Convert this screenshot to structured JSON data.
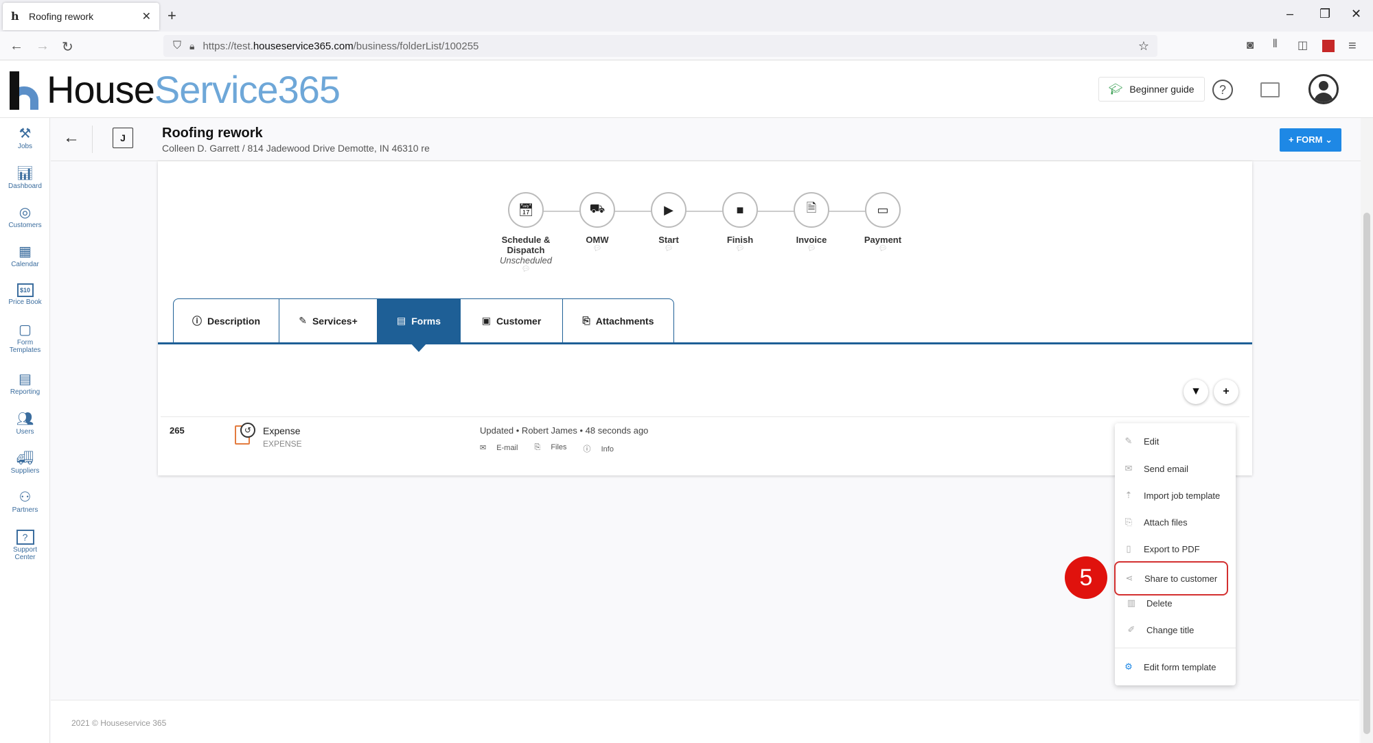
{
  "browser": {
    "tab_title": "Roofing rework",
    "url_prefix": "https://test.",
    "url_host": "houseservice365.com",
    "url_path": "/business/folderList/100255"
  },
  "brand": {
    "word1": "House",
    "word2": "Service365"
  },
  "header": {
    "beginner_guide": "Beginner guide"
  },
  "sidebar": {
    "items": [
      {
        "label": "Jobs",
        "icon": "tools-icon"
      },
      {
        "label": "Dashboard",
        "icon": "bar-chart-icon"
      },
      {
        "label": "Customers",
        "icon": "target-icon"
      },
      {
        "label": "Calendar",
        "icon": "calendar-icon"
      },
      {
        "label": "Price Book",
        "icon": "price-tag-icon"
      },
      {
        "label": "Form Templates",
        "icon": "form-icon"
      },
      {
        "label": "Reporting",
        "icon": "report-icon"
      },
      {
        "label": "Users",
        "icon": "users-icon"
      },
      {
        "label": "Suppliers",
        "icon": "truck-icon"
      },
      {
        "label": "Partners",
        "icon": "partners-icon"
      },
      {
        "label": "Support Center",
        "icon": "support-icon"
      }
    ],
    "price_tag": "$10"
  },
  "job": {
    "badge": "J",
    "title": "Roofing rework",
    "subtitle": "Colleen D. Garrett / 814 Jadewood Drive Demotte, IN 46310 re",
    "form_button": "+ FORM ⌄"
  },
  "steps": [
    {
      "label": "Schedule & Dispatch",
      "sub": "Unscheduled",
      "icon": "calendar-check-icon"
    },
    {
      "label": "OMW",
      "sub": "",
      "icon": "truck-icon"
    },
    {
      "label": "Start",
      "sub": "",
      "icon": "play-icon"
    },
    {
      "label": "Finish",
      "sub": "",
      "icon": "stop-icon"
    },
    {
      "label": "Invoice",
      "sub": "",
      "icon": "document-icon"
    },
    {
      "label": "Payment",
      "sub": "",
      "icon": "card-icon"
    }
  ],
  "tabs": [
    {
      "label": "Description",
      "icon": "ⓘ"
    },
    {
      "label": "Services+",
      "icon": "✎"
    },
    {
      "label": "Forms",
      "icon": "▤"
    },
    {
      "label": "Customer",
      "icon": "▣"
    },
    {
      "label": "Attachments",
      "icon": "⎘"
    }
  ],
  "form_row": {
    "number": "265",
    "name": "Expense",
    "type": "EXPENSE",
    "updated": "Updated • Robert James • 48 seconds ago",
    "links": [
      "E-mail",
      "Files",
      "Info"
    ]
  },
  "menu": {
    "items": [
      {
        "label": "Edit",
        "icon": "✎"
      },
      {
        "label": "Send email",
        "icon": "✉"
      },
      {
        "label": "Import job template",
        "icon": "⇡"
      },
      {
        "label": "Attach files",
        "icon": "⎘"
      },
      {
        "label": "Export to PDF",
        "icon": "▯"
      },
      {
        "label": "Share to customer",
        "icon": "⋖"
      },
      {
        "label": "Delete",
        "icon": "▥"
      },
      {
        "label": "Change title",
        "icon": "✐"
      },
      {
        "label": "Edit form template",
        "icon": "⚙"
      }
    ]
  },
  "annotation": {
    "step": "5"
  },
  "footer": {
    "copyright": "2021 © Houseservice 365"
  }
}
